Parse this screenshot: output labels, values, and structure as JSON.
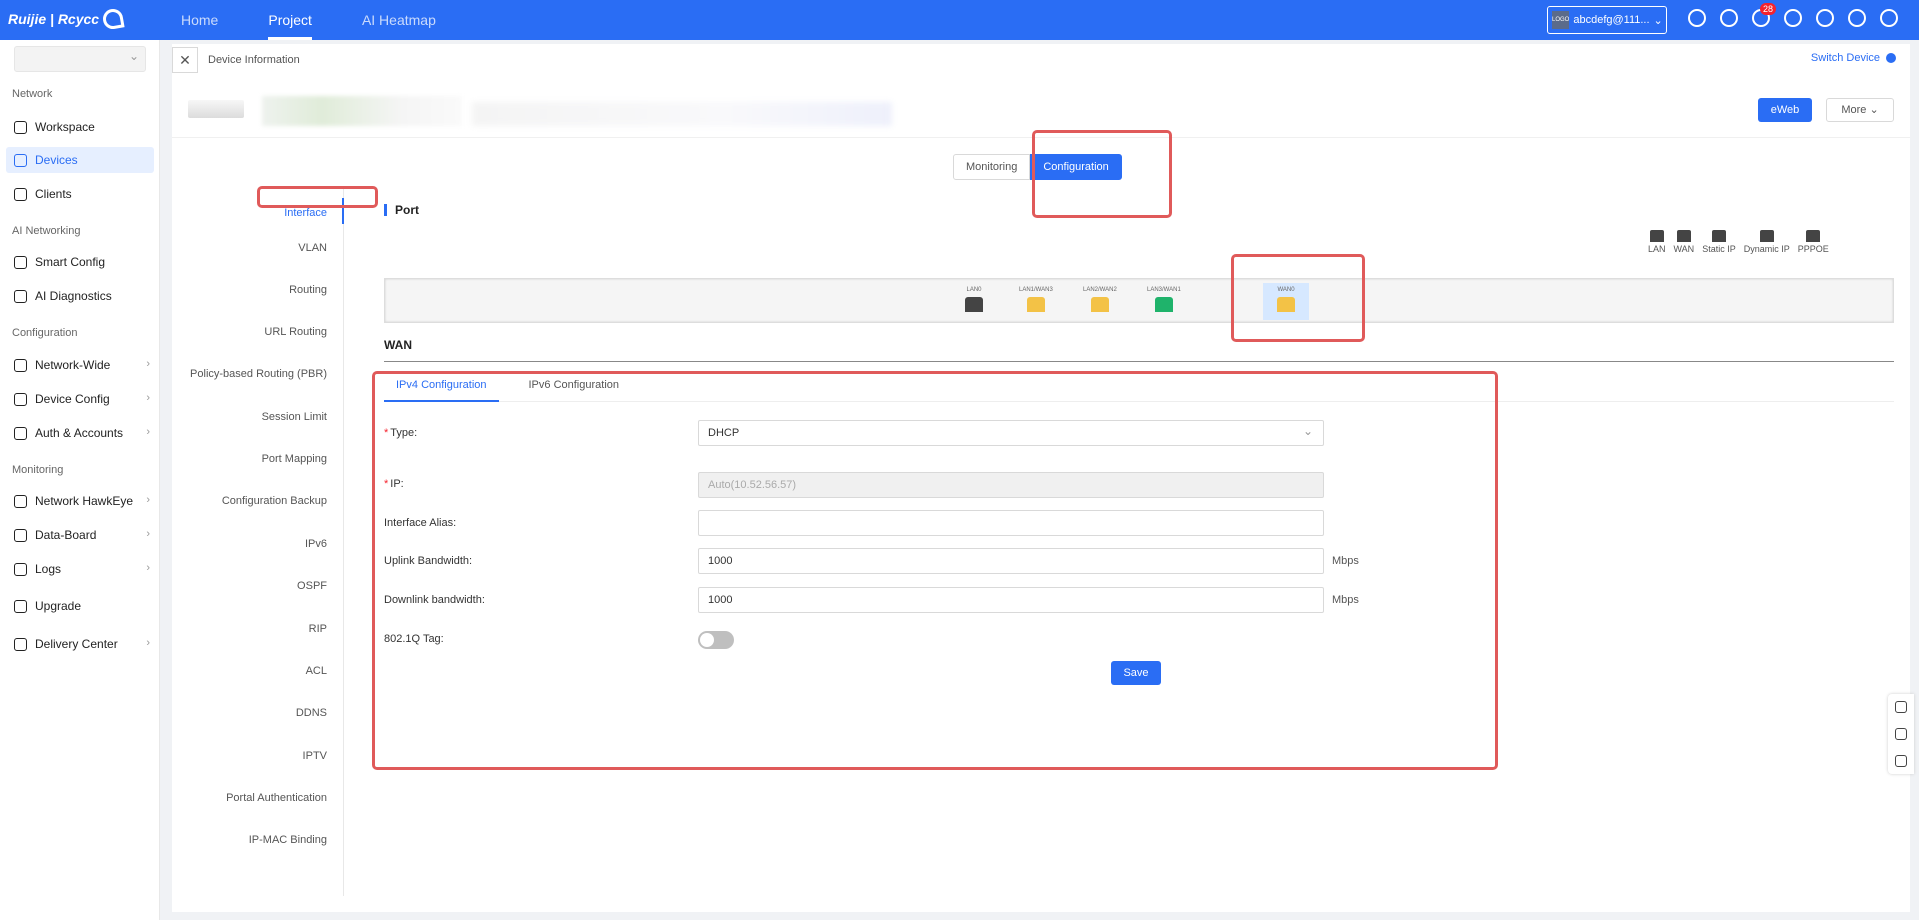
{
  "topbar": {
    "brand": "Ruijie | Rcycc",
    "nav": [
      "Home",
      "Project",
      "AI Heatmap"
    ],
    "active_nav": "Project",
    "account": "abcdefg@111...",
    "account_logo": "LOGO",
    "notification_count": "28",
    "icons": [
      "plus-circle-icon",
      "search-icon",
      "bell-icon",
      "alarm-icon",
      "globe-icon",
      "gear-icon",
      "user-icon"
    ]
  },
  "sidebar": {
    "sections": {
      "network": "Network",
      "ai_networking": "AI Networking",
      "configuration": "Configuration",
      "monitoring": "Monitoring"
    },
    "items": {
      "workspace": "Workspace",
      "devices": "Devices",
      "clients": "Clients",
      "smart_config": "Smart Config",
      "ai_diagnostics": "AI Diagnostics",
      "network_wide": "Network-Wide",
      "device_config": "Device Config",
      "auth_accounts": "Auth & Accounts",
      "network_hawkeye": "Network HawkEye",
      "data_board": "Data-Board",
      "logs": "Logs",
      "upgrade": "Upgrade",
      "delivery_center": "Delivery Center"
    }
  },
  "breadcrumb": {
    "title": "Device Information",
    "switch_device": "Switch Device"
  },
  "device_header": {
    "eweb": "eWeb",
    "more": "More"
  },
  "mode_tabs": {
    "monitoring": "Monitoring",
    "configuration": "Configuration"
  },
  "left_menu": [
    "Interface",
    "VLAN",
    "Routing",
    "URL Routing",
    "Policy-based Routing (PBR)",
    "Session Limit",
    "Port Mapping",
    "Configuration Backup",
    "IPv6",
    "OSPF",
    "RIP",
    "ACL",
    "DDNS",
    "IPTV",
    "Portal Authentication",
    "IP-MAC Binding"
  ],
  "port": {
    "title": "Port",
    "legend": [
      "LAN",
      "WAN",
      "Static IP",
      "Dynamic IP",
      "PPPOE"
    ],
    "ports": [
      {
        "label": "LAN0",
        "color": "#444444"
      },
      {
        "label": "LAN1/WAN3",
        "color": "#f3c246"
      },
      {
        "label": "LAN2/WAN2",
        "color": "#f3c246"
      },
      {
        "label": "LAN3/WAN1",
        "color": "#1fb36b"
      },
      {
        "label": "WAN0",
        "color": "#f3c246"
      }
    ]
  },
  "wan": {
    "title": "WAN",
    "tabs": [
      "IPv4 Configuration",
      "IPv6 Configuration"
    ],
    "type_label": "Type:",
    "type_value": "DHCP",
    "ip_label": "IP:",
    "ip_value": "Auto(10.52.56.57)",
    "alias_label": "Interface Alias:",
    "alias_value": "",
    "uplink_label": "Uplink Bandwidth:",
    "uplink_value": "1000",
    "downlink_label": "Downlink bandwidth:",
    "downlink_value": "1000",
    "unit": "Mbps",
    "tag_label": "802.1Q Tag:",
    "tag_enabled": false,
    "save": "Save"
  },
  "colors": {
    "primary": "#2a6df4",
    "annotation": "#e05a5a"
  }
}
